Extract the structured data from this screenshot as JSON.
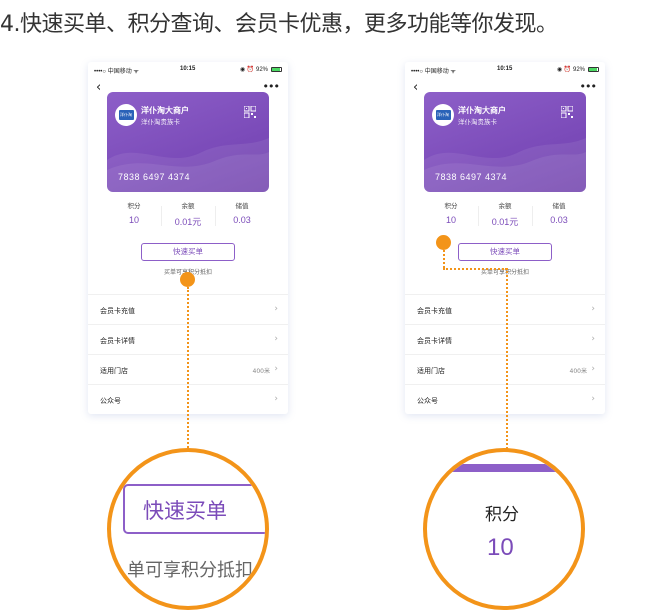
{
  "headline": "4.快速买单、积分查询、会员卡优惠，更多功能等你发现。",
  "colors": {
    "accent": "#7b4bb9",
    "card": "#8d5fc8",
    "marker": "#f39419"
  },
  "status_bar": {
    "carrier": "••••○ 中国移动 ᯤ",
    "time": "10:15",
    "battery": "◉ ⏰ 92%"
  },
  "nav": {
    "back_icon": "‹",
    "more_icon": "•••"
  },
  "card": {
    "name": "洋仆淘大商户",
    "subtitle": "洋仆淘贵族卡",
    "number": "7838  6497  4374",
    "logo_text": "洋仆淘"
  },
  "stats": [
    {
      "label": "积分",
      "value": "10"
    },
    {
      "label": "余额",
      "value": "0.01元"
    },
    {
      "label": "储值",
      "value": "0.03"
    }
  ],
  "quick_pay_button": "快速买单",
  "quick_pay_note": "买单可享积分抵扣",
  "menu": [
    {
      "label": "会员卡充值",
      "extra": ""
    },
    {
      "label": "会员卡详情",
      "extra": ""
    },
    {
      "label": "适用门店",
      "extra": "400米"
    },
    {
      "label": "公众号",
      "extra": ""
    }
  ],
  "zoom_left": {
    "button": "快速买单",
    "note": "单可享积分抵扣"
  },
  "zoom_right": {
    "label": "积分",
    "value": "10"
  }
}
